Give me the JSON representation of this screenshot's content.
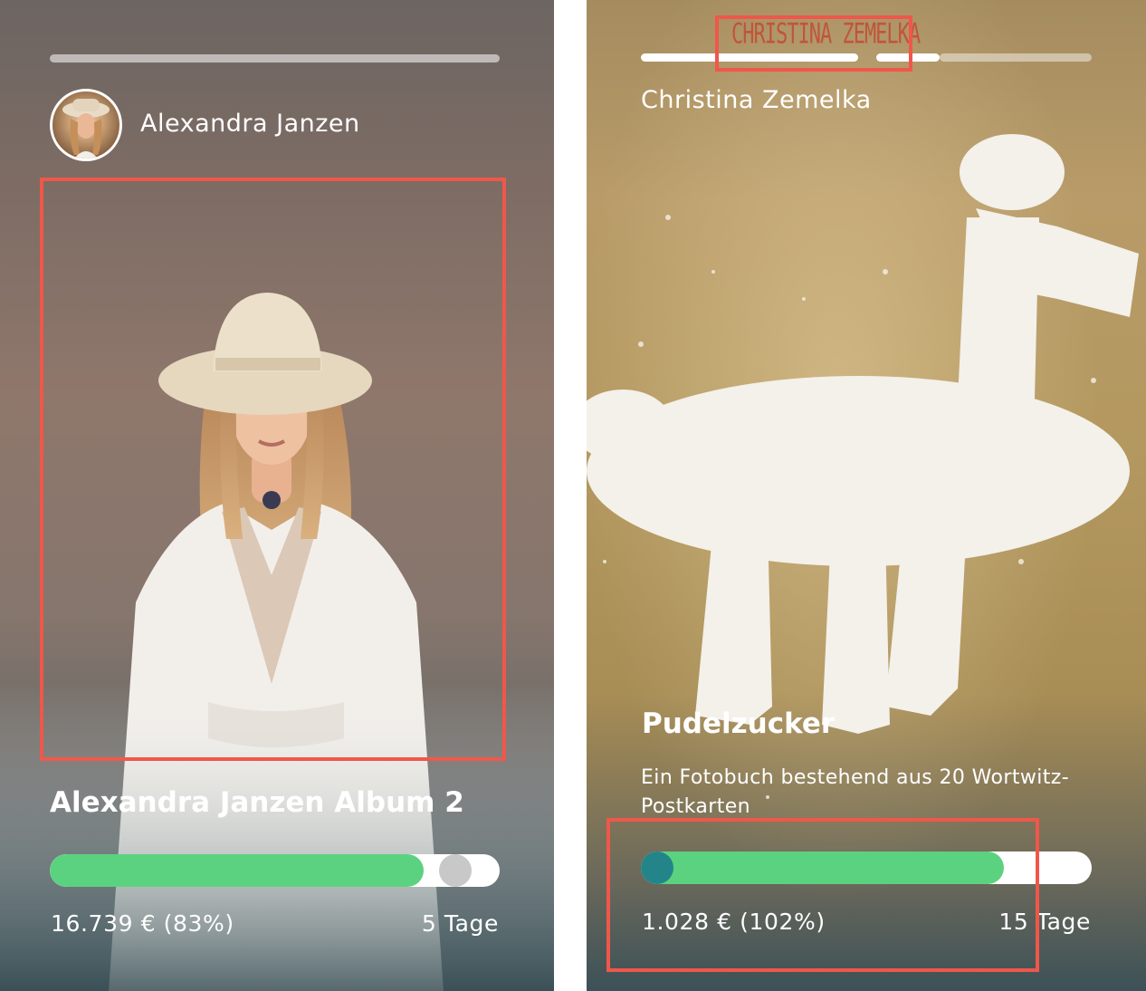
{
  "cards": [
    {
      "creator_name": "Alexandra Janzen",
      "title": "Alexandra Janzen Album 2",
      "amount_text": "16.739 € (83%)",
      "days_text": "5 Tage",
      "funding_fraction": 0.83,
      "avatar_icon": "person-portrait-icon",
      "image_icon": "portrait-photo-icon"
    },
    {
      "creator_name": "Christina Zemelka",
      "brand_watermark": "CHRISTINA ZEMELKA",
      "title": "Pudelzucker",
      "description": "Ein Fotobuch bestehend aus 20 Wortwitz-Postkarten",
      "amount_text": "1.028 € (102%)",
      "days_text": "15 Tage",
      "funding_fraction": 1.02,
      "image_icon": "sugar-poodle-photo-icon"
    }
  ],
  "colors": {
    "highlight": "#f0574a",
    "progress_green": "#5bd27f",
    "knob_teal": "#23858a",
    "knob_gray": "#c8c8c8"
  }
}
